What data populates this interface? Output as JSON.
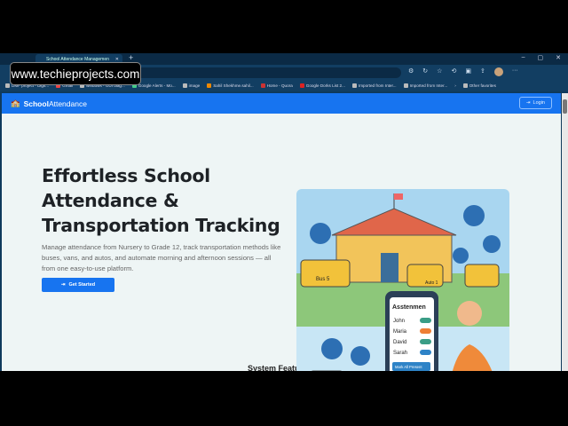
{
  "watermark": "www.techieprojects.com",
  "browser": {
    "tab_title": "School Attendance Managemen",
    "bookmarks": [
      "DMF project - Digit...",
      "Gmail",
      "windows - GUI diag...",
      "Google Alerts - Mo...",
      "image",
      "Sahil Shekhme.sahil...",
      "Home - Quora",
      "Google Dorks List 2...",
      "Imported from Inter...",
      "Imported from Inter...",
      "Other favorites"
    ]
  },
  "nav": {
    "brand_bold": "School",
    "brand_rest": "Attendance",
    "login": "Login"
  },
  "hero": {
    "title": "Effortless School Attendance & Transportation Tracking",
    "description": "Manage attendance from Nursery to Grade 12, track transportation methods like buses, vans, and autos, and automate morning and afternoon sessions — all from one easy-to-use platform.",
    "cta": "Get Started"
  },
  "illustration": {
    "bus_label": "Bus 5",
    "auto_label": "Auto 1",
    "phone_title": "Asstenmen",
    "students": [
      "John",
      "Maria",
      "David",
      "Sarah"
    ],
    "mark_all": "Mark All Present"
  },
  "features_heading": "System Features"
}
